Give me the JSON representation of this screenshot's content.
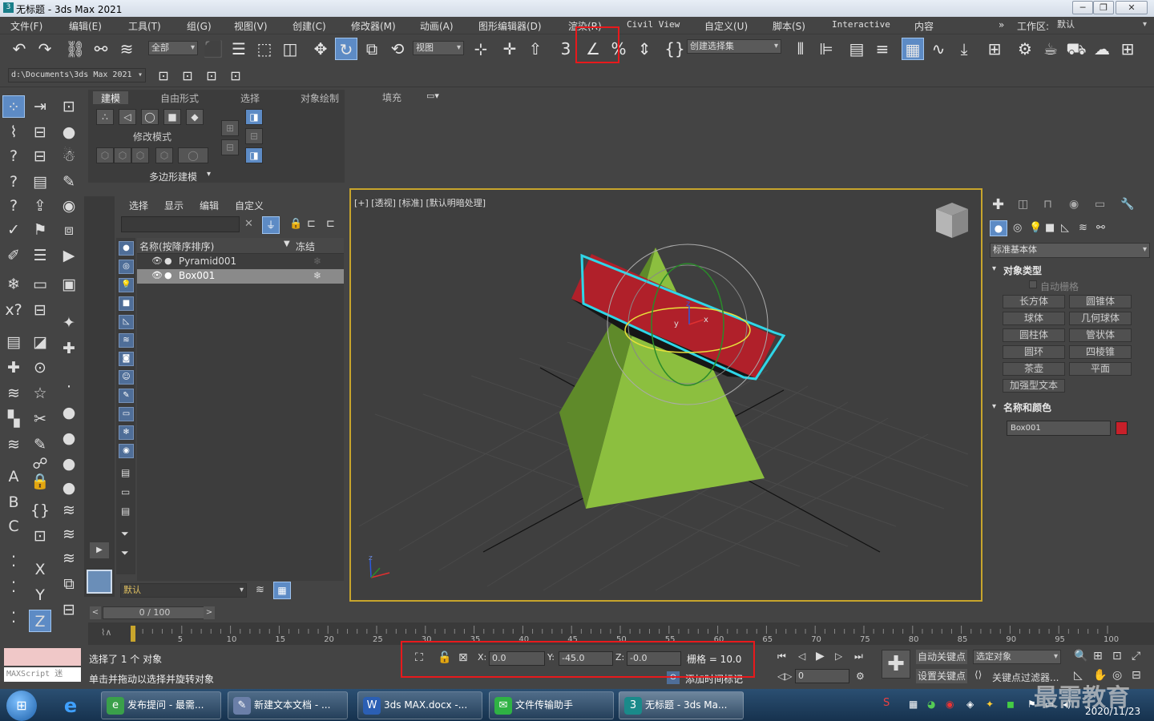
{
  "window": {
    "title": "无标题 - 3ds Max 2021",
    "app_icon": "3",
    "minimize": "─",
    "maximize": "❐",
    "close": "✕"
  },
  "menu": [
    "文件(F)",
    "编辑(E)",
    "工具(T)",
    "组(G)",
    "视图(V)",
    "创建(C)",
    "修改器(M)",
    "动画(A)",
    "图形编辑器(D)",
    "渲染(R)",
    "Civil View",
    "自定义(U)",
    "脚本(S)",
    "Interactive",
    "内容"
  ],
  "workspace": {
    "label": "工作区:",
    "value": "默认",
    "expand": "»"
  },
  "toolbar": {
    "selection_filter": "全部",
    "ref_coord": "视图",
    "named_selection": "创建选择集",
    "highlight_color": "#e8191c"
  },
  "project_path": "d:\\Documents\\3ds Max 2021",
  "ribbon": {
    "tabs": [
      "建模",
      "自由形式",
      "选择",
      "对象绘制",
      "填充"
    ],
    "active_tab": "建模",
    "group1": "修改模式",
    "group2": "多边形建模"
  },
  "scene_explorer": {
    "tabs": [
      "选择",
      "显示",
      "编辑",
      "自定义"
    ],
    "columns": [
      "名称(按降序排序)",
      "冻结"
    ],
    "sort_arrow": "▼",
    "rows": [
      {
        "name": "Pyramid001",
        "selected": false
      },
      {
        "name": "Box001",
        "selected": true
      }
    ],
    "layer": "默认",
    "clear": "✕"
  },
  "viewport": {
    "label": "[+] [透视] [标准] [默认明暗处理]",
    "border_color": "#c8a52c",
    "pyramid_color": "#8cbf3f",
    "box_color": "#b0202a",
    "selection_color": "#2fd6e8",
    "axis_labels": {
      "x": "x",
      "y": "y",
      "z": "z"
    }
  },
  "command_panel": {
    "category": "标准基本体",
    "object_type_header": "对象类型",
    "auto_grid": "自动栅格",
    "buttons": [
      "长方体",
      "圆锥体",
      "球体",
      "几何球体",
      "圆柱体",
      "管状体",
      "圆环",
      "四棱锥",
      "茶壶",
      "平面",
      "加强型文本"
    ],
    "name_color_header": "名称和颜色",
    "object_name": "Box001",
    "object_color": "#c8202a",
    "collapse": "▾"
  },
  "timeline": {
    "frame": "0 / 100",
    "prev": "<",
    "next": ">",
    "ticks": [
      "5",
      "10",
      "15",
      "20",
      "25",
      "30",
      "35",
      "40",
      "45",
      "50",
      "55",
      "60",
      "65",
      "70",
      "75",
      "80",
      "85",
      "90",
      "95",
      "100"
    ],
    "track_icon": "⌇∧",
    "start": "0"
  },
  "status": {
    "maxscript": "MAXScript 迷",
    "selected": "选择了 1 个 对象",
    "hint": "单击并拖动以选择并旋转对象",
    "x_label": "X:",
    "x": "0.0",
    "y_label": "Y:",
    "y": "-45.0",
    "z_label": "Z:",
    "z": "-0.0",
    "grid": "栅格 = 10.0",
    "add_time_tag": "添加时间标记",
    "auto_key": "自动关键点",
    "selected_object": "选定对象",
    "set_key": "设置关键点",
    "key_filter": "关键点过滤器...",
    "current_frame": "0"
  },
  "taskbar": {
    "items": [
      {
        "label": "发布提问 - 最需...",
        "icon": "e",
        "color": "#3aa04a"
      },
      {
        "label": "新建文本文档 - ...",
        "icon": "✎",
        "color": "#6b7fa8"
      },
      {
        "label": "3ds MAX.docx -...",
        "icon": "W",
        "color": "#2b5fb4"
      },
      {
        "label": "文件传输助手",
        "icon": "✉",
        "color": "#2fb244"
      },
      {
        "label": "无标题 - 3ds Ma...",
        "icon": "3",
        "color": "#1a8a8a"
      }
    ],
    "date": "2020/11/23",
    "watermark": "最需教育"
  }
}
